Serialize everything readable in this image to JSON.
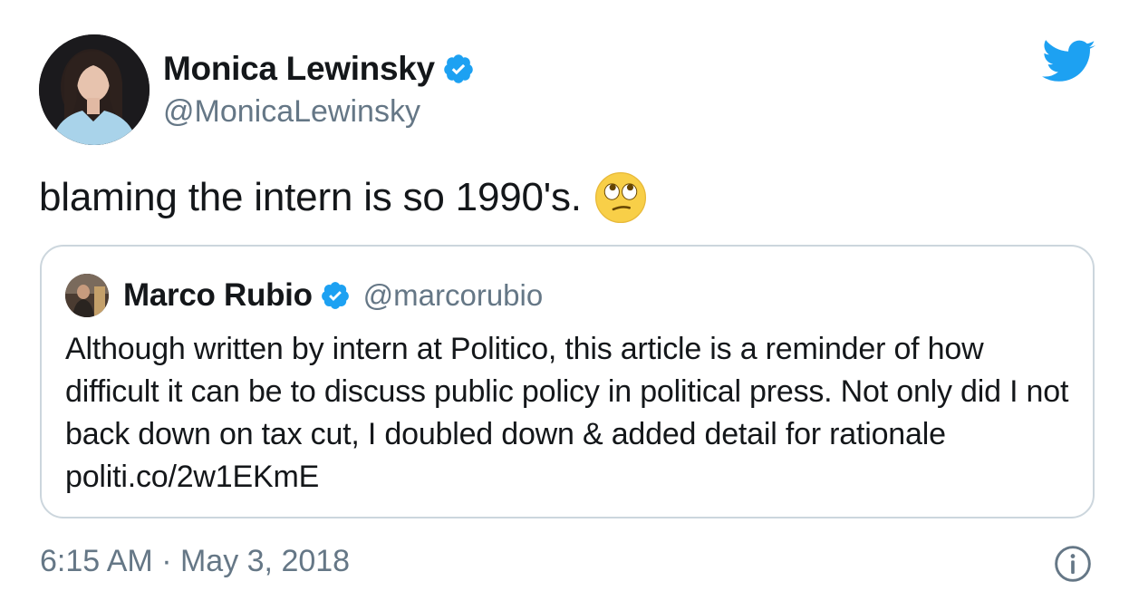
{
  "author": {
    "name": "Monica Lewinsky",
    "handle": "@MonicaLewinsky",
    "verified": true
  },
  "tweet": {
    "text": "blaming the intern is so 1990's.",
    "emoji": "face-with-rolling-eyes"
  },
  "quoted_tweet": {
    "name": "Marco Rubio",
    "handle": "@marcorubio",
    "verified": true,
    "text": "Although written by intern at Politico, this article is a reminder of how difficult it can be to discuss public policy in political press. Not only did I not back down on tax cut, I doubled down & added detail for rationale politi.co/2w1EKmE"
  },
  "footer": {
    "timestamp": "6:15 AM · May 3, 2018"
  },
  "colors": {
    "twitter_blue": "#1da1f2",
    "text_primary": "#14171a",
    "text_secondary": "#657786",
    "border": "#ccd6dd"
  },
  "icons": {
    "logo": "twitter-bird-icon",
    "verified": "verified-badge-icon",
    "info": "info-icon"
  }
}
